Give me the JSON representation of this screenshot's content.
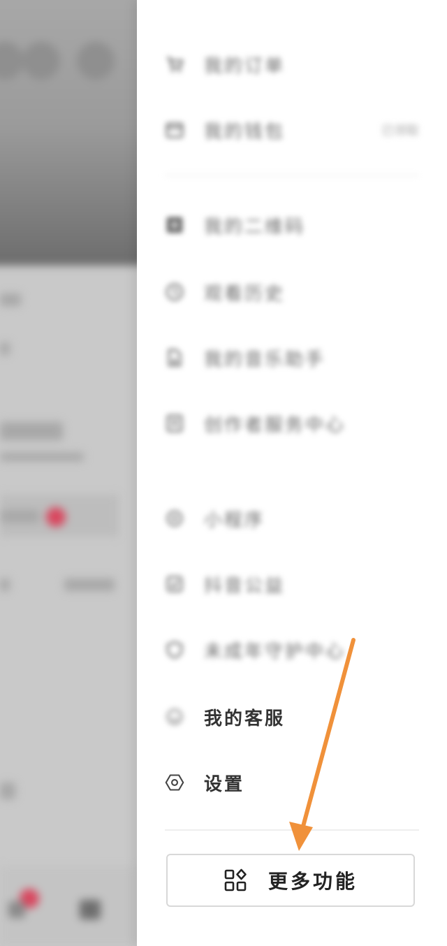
{
  "background_app": {
    "badge_color": "#d9465e"
  },
  "menu": {
    "items": [
      {
        "name": "menu-item-1",
        "label": "我的订单",
        "icon": "cart-icon",
        "trail": ""
      },
      {
        "name": "menu-item-2",
        "label": "我的钱包",
        "icon": "wallet-icon",
        "trail": "已领取"
      },
      {
        "name": "menu-item-3",
        "label": "我的二维码",
        "icon": "qrcode-icon",
        "trail": ""
      },
      {
        "name": "menu-item-4",
        "label": "观看历史",
        "icon": "clock-icon",
        "trail": ""
      },
      {
        "name": "menu-item-5",
        "label": "我的音乐助手",
        "icon": "music-icon",
        "trail": ""
      },
      {
        "name": "menu-item-6",
        "label": "创作者服务中心",
        "icon": "creator-icon",
        "trail": ""
      },
      {
        "name": "menu-item-7",
        "label": "小程序",
        "icon": "mini-program-icon",
        "trail": ""
      },
      {
        "name": "menu-item-8",
        "label": "抖音公益",
        "icon": "charity-icon",
        "trail": ""
      },
      {
        "name": "menu-item-9",
        "label": "未成年守护中心",
        "icon": "shield-icon",
        "trail": ""
      },
      {
        "name": "menu-item-customer-service",
        "label": "我的客服",
        "icon": "headset-icon",
        "trail": ""
      },
      {
        "name": "menu-item-settings",
        "label": "设置",
        "icon": "settings-hexagon-icon",
        "trail": ""
      }
    ],
    "more_button": {
      "label": "更多功能",
      "icon": "grid-apps-icon"
    }
  },
  "annotation": {
    "arrow_color": "#f0913a"
  }
}
